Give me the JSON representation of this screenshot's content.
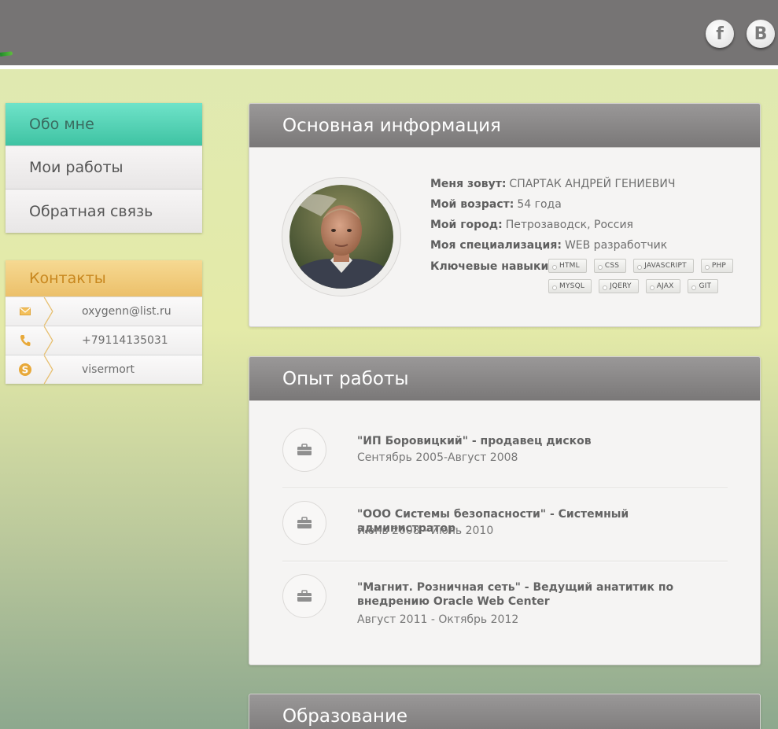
{
  "social": {
    "facebook": "f",
    "vk": "B"
  },
  "nav": {
    "items": [
      {
        "label": "Обо мне"
      },
      {
        "label": "Мои работы"
      },
      {
        "label": "Обратная связь"
      }
    ]
  },
  "contacts": {
    "title": "Контакты",
    "items": [
      {
        "icon": "mail-icon",
        "value": "oxygenn@list.ru"
      },
      {
        "icon": "phone-icon",
        "value": "+79114135031"
      },
      {
        "icon": "skype-icon",
        "value": "visermort"
      }
    ]
  },
  "basic": {
    "title": "Основная информация",
    "name_label": "Меня зовут:",
    "name_value": "СПАРТАК АНДРЕЙ ГЕНИЕВИЧ",
    "age_label": "Мой возраст:",
    "age_value": "54 года",
    "city_label": "Мой город:",
    "city_value": "Петрозаводск, Россия",
    "spec_label": "Моя специализация:",
    "spec_value": "WEB разработчик",
    "skills_label": "Ключевые навыки:",
    "skills": [
      "HTML",
      "CSS",
      "JAVASCRIPT",
      "PHP",
      "MYSQL",
      "JQERY",
      "AJAX",
      "GIT"
    ]
  },
  "experience": {
    "title": "Опыт работы",
    "jobs": [
      {
        "title": "\"ИП Боровицкий\" - продавец дисков",
        "date": "Сентябрь 2005-Август 2008"
      },
      {
        "title": "\"ООО Системы безопасности\" - Системный администратор",
        "date": "Июнь 2008 - Июль 2010"
      },
      {
        "title": "\"Магнит. Розничная сеть\" - Ведущий анатитик по внедрению Oracle Web Center",
        "date": "Август 2011 - Октябрь 2012"
      }
    ]
  },
  "education": {
    "title": "Образование"
  }
}
